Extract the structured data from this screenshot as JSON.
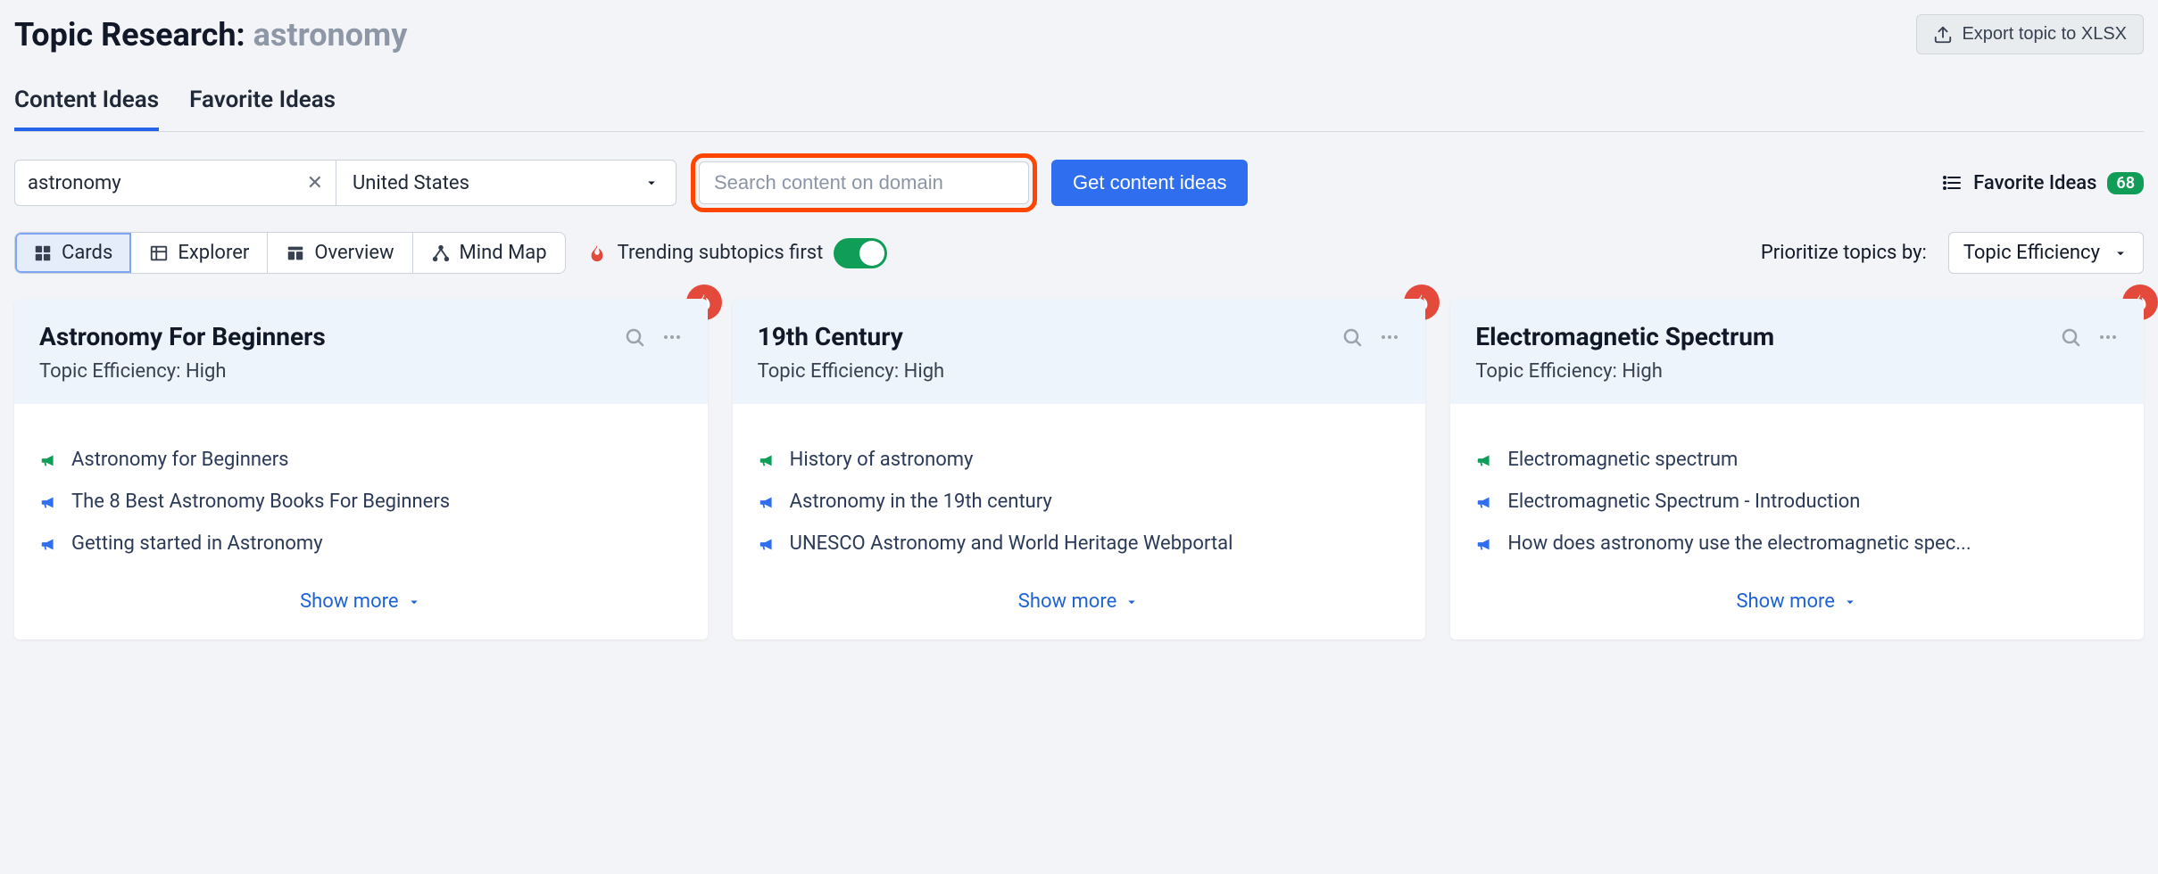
{
  "header": {
    "title_prefix": "Topic Research:",
    "title_subject": "astronomy",
    "export_label": "Export topic to XLSX"
  },
  "tabs": {
    "content_ideas": "Content Ideas",
    "favorite_ideas": "Favorite Ideas"
  },
  "search": {
    "keyword": "astronomy",
    "country": "United States",
    "domain_placeholder": "Search content on domain",
    "get_ideas_label": "Get content ideas"
  },
  "fav": {
    "label": "Favorite Ideas",
    "count": "68"
  },
  "views": {
    "cards": "Cards",
    "explorer": "Explorer",
    "overview": "Overview",
    "mindmap": "Mind Map"
  },
  "trending_label": "Trending subtopics first",
  "prioritize_label": "Prioritize topics by:",
  "prioritize_value": "Topic Efficiency",
  "cards": [
    {
      "title": "Astronomy For Beginners",
      "efficiency_label": "Topic Efficiency:",
      "efficiency_value": "High",
      "items": [
        {
          "icon": "green",
          "text": "Astronomy for Beginners"
        },
        {
          "icon": "blue",
          "text": "The 8 Best Astronomy Books For Beginners"
        },
        {
          "icon": "blue",
          "text": "Getting started in Astronomy"
        }
      ],
      "show_more": "Show more"
    },
    {
      "title": "19th Century",
      "efficiency_label": "Topic Efficiency:",
      "efficiency_value": "High",
      "items": [
        {
          "icon": "green",
          "text": "History of astronomy"
        },
        {
          "icon": "blue",
          "text": "Astronomy in the 19th century"
        },
        {
          "icon": "blue",
          "text": "UNESCO Astronomy and World Heritage Webportal"
        }
      ],
      "show_more": "Show more"
    },
    {
      "title": "Electromagnetic Spectrum",
      "efficiency_label": "Topic Efficiency:",
      "efficiency_value": "High",
      "items": [
        {
          "icon": "green",
          "text": "Electromagnetic spectrum"
        },
        {
          "icon": "blue",
          "text": "Electromagnetic Spectrum - Introduction"
        },
        {
          "icon": "blue",
          "text": "How does astronomy use the electromagnetic spec..."
        }
      ],
      "show_more": "Show more"
    }
  ]
}
